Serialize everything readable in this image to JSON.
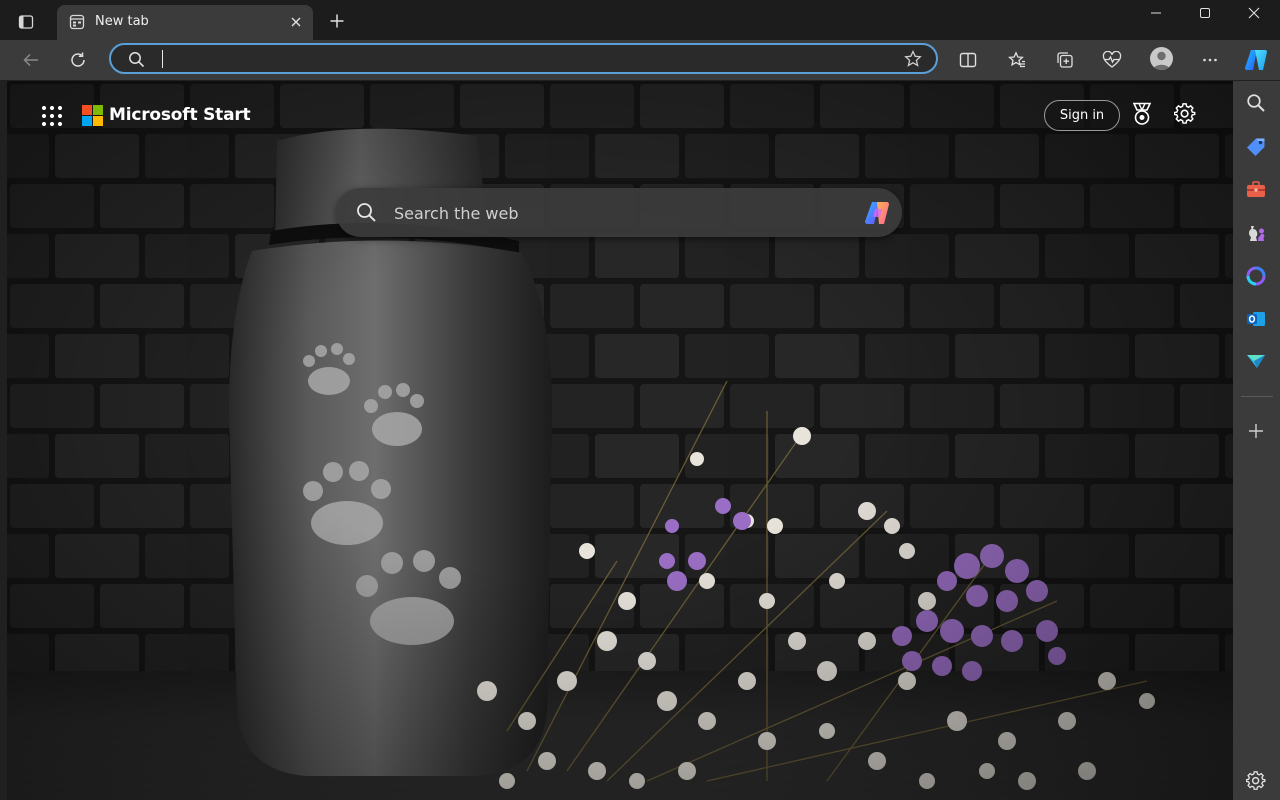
{
  "browser": {
    "tab": {
      "title": "New tab"
    },
    "address_bar": {
      "value": "",
      "placeholder": ""
    }
  },
  "page": {
    "brand": "Microsoft Start",
    "sign_in_label": "Sign in",
    "search": {
      "placeholder": "Search the web"
    }
  },
  "colors": {
    "accent": "#5b9fd9",
    "ms_red": "#f25022",
    "ms_green": "#7fba00",
    "ms_blue": "#00a4ef",
    "ms_yellow": "#ffb900"
  },
  "icons": {
    "tab_actions": "tab-actions-icon",
    "back": "back-arrow-icon",
    "refresh": "refresh-icon",
    "favorites": "star-icon",
    "split_screen": "split-screen-icon",
    "favorites_list": "favorites-icon",
    "collections": "collections-icon",
    "browser_essentials": "heart-pulse-icon",
    "profile": "avatar",
    "more": "ellipsis-icon",
    "copilot": "copilot-icon",
    "apps": "app-launcher-icon",
    "rewards": "rewards-icon",
    "page_settings": "gear-icon",
    "sidebar": [
      "search-icon",
      "shopping-tag-icon",
      "tools-icon",
      "games-icon",
      "copilot-icon",
      "outlook-icon",
      "drop-icon",
      "add-icon",
      "gear-icon"
    ]
  }
}
